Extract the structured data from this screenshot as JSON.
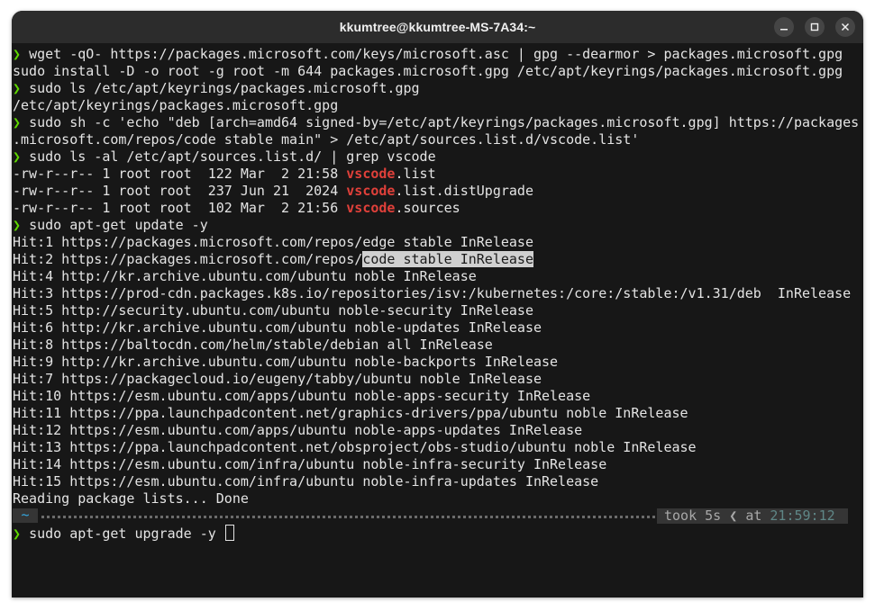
{
  "window": {
    "title": "kkumtree@kkumtree-MS-7A34:~",
    "buttons": [
      "minimize-icon",
      "maximize-icon",
      "close-icon"
    ]
  },
  "colors": {
    "background": "#171717",
    "prompt_chevron": "#5fd700",
    "grep_match": "#e0403a",
    "selection": "#d0d0d0"
  },
  "prompt": {
    "symbol": "❯",
    "dir": "~",
    "took": "took 5s",
    "at_label": "at",
    "time": "21:59:12",
    "current_command": "sudo apt-get upgrade -y"
  },
  "lines": [
    {
      "type": "cmd",
      "text": "wget -qO- https://packages.microsoft.com/keys/microsoft.asc | gpg --dearmor > packages.microsoft.gpg"
    },
    {
      "type": "out",
      "text": "sudo install -D -o root -g root -m 644 packages.microsoft.gpg /etc/apt/keyrings/packages.microsoft.gpg"
    },
    {
      "type": "cmd",
      "text": "sudo ls /etc/apt/keyrings/packages.microsoft.gpg"
    },
    {
      "type": "out",
      "text": "/etc/apt/keyrings/packages.microsoft.gpg"
    },
    {
      "type": "cmd",
      "text": "sudo sh -c 'echo \"deb [arch=amd64 signed-by=/etc/apt/keyrings/packages.microsoft.gpg] https://packages"
    },
    {
      "type": "out",
      "text": ".microsoft.com/repos/code stable main\" > /etc/apt/sources.list.d/vscode.list'"
    },
    {
      "type": "cmd",
      "text": "sudo ls -al /etc/apt/sources.list.d/ | grep vscode"
    },
    {
      "type": "match",
      "pre": "-rw-r--r-- 1 root root  122 Mar  2 21:58 ",
      "match": "vscode",
      "post": ".list"
    },
    {
      "type": "match",
      "pre": "-rw-r--r-- 1 root root  237 Jun 21  2024 ",
      "match": "vscode",
      "post": ".list.distUpgrade"
    },
    {
      "type": "match",
      "pre": "-rw-r--r-- 1 root root  102 Mar  2 21:56 ",
      "match": "vscode",
      "post": ".sources"
    },
    {
      "type": "cmd",
      "text": "sudo apt-get update -y"
    },
    {
      "type": "out",
      "text": "Hit:1 https://packages.microsoft.com/repos/edge stable InRelease"
    },
    {
      "type": "sel",
      "pre": "Hit:2 https://packages.microsoft.com/repos/",
      "sel": "code stable InRelease"
    },
    {
      "type": "out",
      "text": "Hit:4 http://kr.archive.ubuntu.com/ubuntu noble InRelease"
    },
    {
      "type": "out",
      "text": "Hit:3 https://prod-cdn.packages.k8s.io/repositories/isv:/kubernetes:/core:/stable:/v1.31/deb  InRelease"
    },
    {
      "type": "out",
      "text": "Hit:5 http://security.ubuntu.com/ubuntu noble-security InRelease"
    },
    {
      "type": "out",
      "text": "Hit:6 http://kr.archive.ubuntu.com/ubuntu noble-updates InRelease"
    },
    {
      "type": "out",
      "text": "Hit:8 https://baltocdn.com/helm/stable/debian all InRelease"
    },
    {
      "type": "out",
      "text": "Hit:9 http://kr.archive.ubuntu.com/ubuntu noble-backports InRelease"
    },
    {
      "type": "out",
      "text": "Hit:7 https://packagecloud.io/eugeny/tabby/ubuntu noble InRelease"
    },
    {
      "type": "out",
      "text": "Hit:10 https://esm.ubuntu.com/apps/ubuntu noble-apps-security InRelease"
    },
    {
      "type": "out",
      "text": "Hit:11 https://ppa.launchpadcontent.net/graphics-drivers/ppa/ubuntu noble InRelease"
    },
    {
      "type": "out",
      "text": "Hit:12 https://esm.ubuntu.com/apps/ubuntu noble-apps-updates InRelease"
    },
    {
      "type": "out",
      "text": "Hit:13 https://ppa.launchpadcontent.net/obsproject/obs-studio/ubuntu noble InRelease"
    },
    {
      "type": "out",
      "text": "Hit:14 https://esm.ubuntu.com/infra/ubuntu noble-infra-security InRelease"
    },
    {
      "type": "out",
      "text": "Hit:15 https://esm.ubuntu.com/infra/ubuntu noble-infra-updates InRelease"
    },
    {
      "type": "out",
      "text": "Reading package lists... Done"
    }
  ]
}
